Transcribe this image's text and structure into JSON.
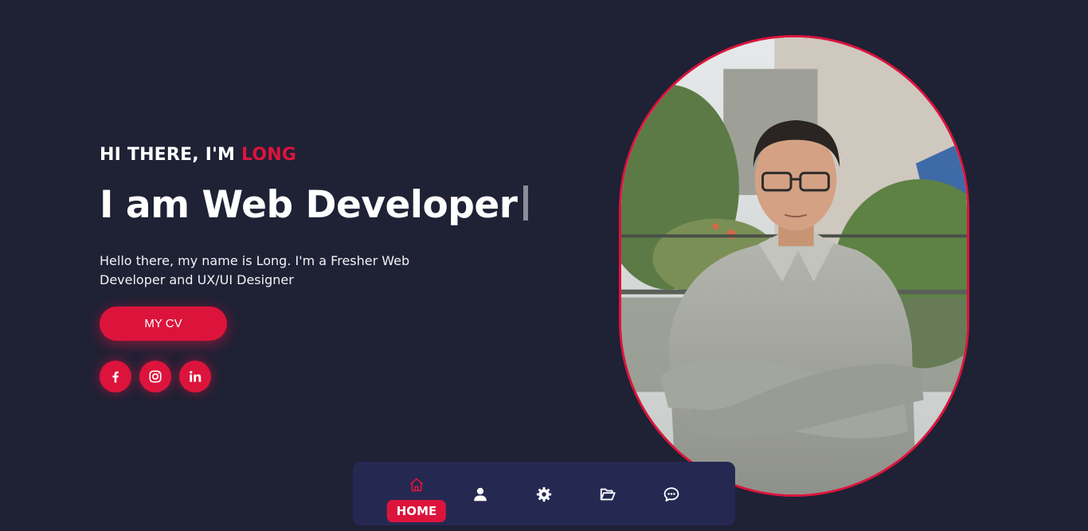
{
  "hero": {
    "greeting_prefix": "HI THERE, I'M ",
    "greeting_name": "LONG",
    "headline": "I am Web Developer",
    "intro": "Hello there, my name is Long. I'm a Fresher Web Developer and UX/UI Designer",
    "cv_button": "MY CV"
  },
  "socials": [
    {
      "icon": "facebook-icon"
    },
    {
      "icon": "instagram-icon"
    },
    {
      "icon": "linkedin-icon"
    }
  ],
  "bottom_nav": {
    "active_label": "HOME",
    "items": [
      {
        "icon": "home-icon",
        "active": true
      },
      {
        "icon": "user-icon",
        "active": false
      },
      {
        "icon": "gear-icon",
        "active": false
      },
      {
        "icon": "folder-open-icon",
        "active": false
      },
      {
        "icon": "chat-icon",
        "active": false
      }
    ]
  },
  "colors": {
    "background": "#1f2135",
    "accent": "#dc143c",
    "nav_background": "#252952"
  }
}
